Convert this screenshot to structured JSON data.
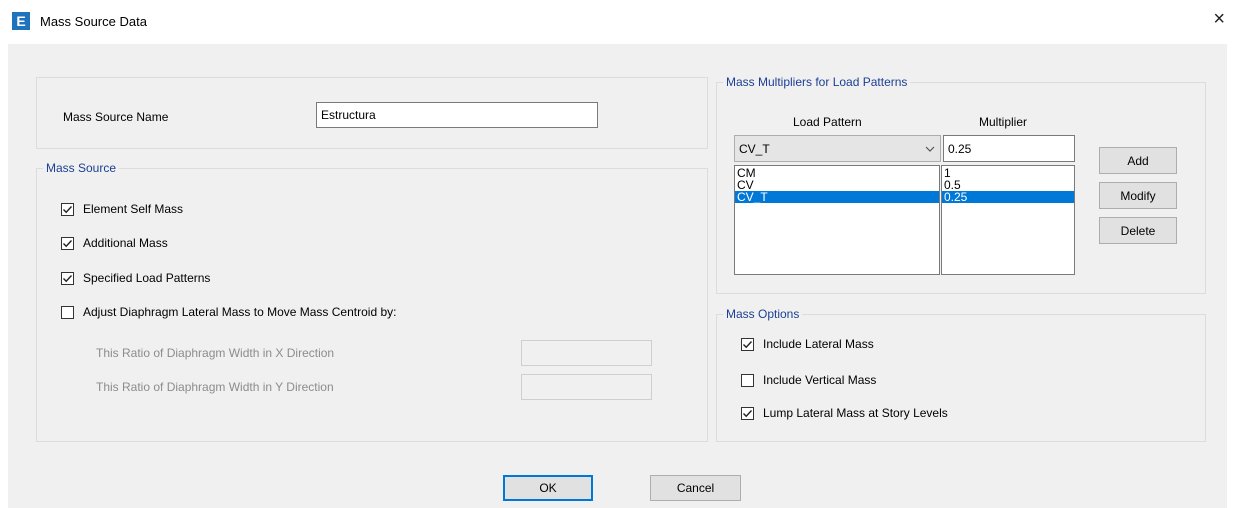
{
  "window": {
    "app_icon_letter": "E",
    "title": "Mass Source Data",
    "close_glyph": "×"
  },
  "mass_source_name": {
    "label": "Mass Source Name",
    "value": "Estructura"
  },
  "mass_source": {
    "legend": "Mass Source",
    "element_self_mass": {
      "label": "Element Self Mass",
      "checked": true
    },
    "additional_mass": {
      "label": "Additional Mass",
      "checked": true
    },
    "specified_load_patterns": {
      "label": "Specified Load Patterns",
      "checked": true
    },
    "adjust_diaphragm": {
      "label": "Adjust Diaphragm Lateral Mass to Move Mass Centroid by:",
      "checked": false
    },
    "ratio_x_label": "This Ratio of Diaphragm Width in X Direction",
    "ratio_y_label": "This Ratio of Diaphragm Width in Y Direction",
    "ratio_x_value": "",
    "ratio_y_value": ""
  },
  "multipliers": {
    "legend": "Mass Multipliers for Load Patterns",
    "col_load_pattern": "Load Pattern",
    "col_multiplier": "Multiplier",
    "selected_pattern": "CV_T",
    "multiplier_value": "0.25",
    "patterns": [
      "CM",
      "CV",
      "CV_T"
    ],
    "values": [
      "1",
      "0.5",
      "0.25"
    ],
    "selected_index": 2,
    "add_label": "Add",
    "modify_label": "Modify",
    "delete_label": "Delete"
  },
  "mass_options": {
    "legend": "Mass Options",
    "include_lateral": {
      "label": "Include Lateral Mass",
      "checked": true
    },
    "include_vertical": {
      "label": "Include Vertical Mass",
      "checked": false
    },
    "lump_lateral": {
      "label": "Lump Lateral Mass at Story Levels",
      "checked": true
    }
  },
  "buttons": {
    "ok": "OK",
    "cancel": "Cancel"
  },
  "colors": {
    "accent": "#0078d7",
    "legend_text": "#1c3f94",
    "app_icon": "#1e73be"
  }
}
